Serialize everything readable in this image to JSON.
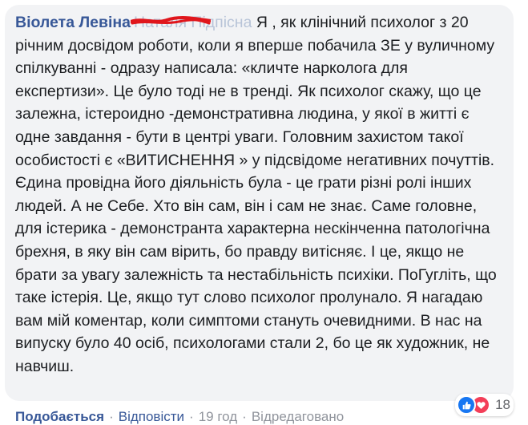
{
  "comment": {
    "author": "Віолета Левіна",
    "tagged_name": "Наталя Підпісна",
    "text": "Я , як клінічний психолог з 20 річним досвідом роботи, коли я вперше побачила ЗЕ у вуличному спілкуванні - одразу написала: «кличте нарколога для експертизи». Це було тоді не в тренді. Як психолог скажу, що це залежна, істероидно -демонстративна людина, у якої в житті є одне завдання - бути в центрі уваги. Головним захистом такої особистості є «ВИТИСНЕННЯ » у підсвідоме негативних почуттів. Єдина провідна його діяльність була - це грати різні ролі інших людей. А не Себе. Хто він сам, він і сам не знає. Саме головне, для істерика - демонстранта характерна нескінченна патологічна брехня, в яку він сам вірить, бо правду витісняє. І це, якщо не брати за увагу залежність та нестабільність психіки. ПоГугліть, що таке істерія. Це, якщо тут слово психолог пролунало. Я нагадаю вам мій коментар, коли симптоми стануть очевидними. В нас на випуску було 40 осіб, психологами стали 2, бо це як художник, не навчиш."
  },
  "reactions": {
    "icons": [
      "like-icon",
      "heart-icon"
    ],
    "count": "18",
    "colors": {
      "like": "#1877f2",
      "love": "#f33e58"
    }
  },
  "actions": {
    "like": "Подобається",
    "reply": "Відповісти",
    "time": "19 год",
    "edited": "Відредаговано"
  },
  "colors": {
    "bubble": "#f2f3f5",
    "link": "#385898",
    "meta": "#90949c",
    "scribble": "#e0161c"
  }
}
